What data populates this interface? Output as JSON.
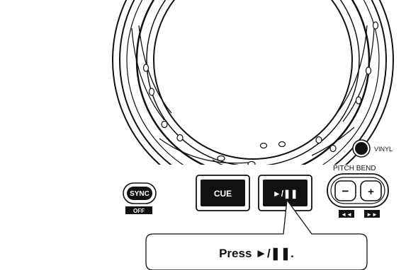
{
  "controls": {
    "sync_label": "SYNC",
    "off_label": "OFF",
    "cue_label": "CUE",
    "play_pause_label": "►/❚❚",
    "vinyl_label": "VINYL",
    "pitch_bend_label": "PITCH BEND",
    "pitch_minus_label": "−",
    "pitch_plus_label": "+",
    "rewind_label": "◄◄",
    "fast_forward_label": "►►"
  },
  "callout": {
    "text": "Press ►/❚❚."
  }
}
